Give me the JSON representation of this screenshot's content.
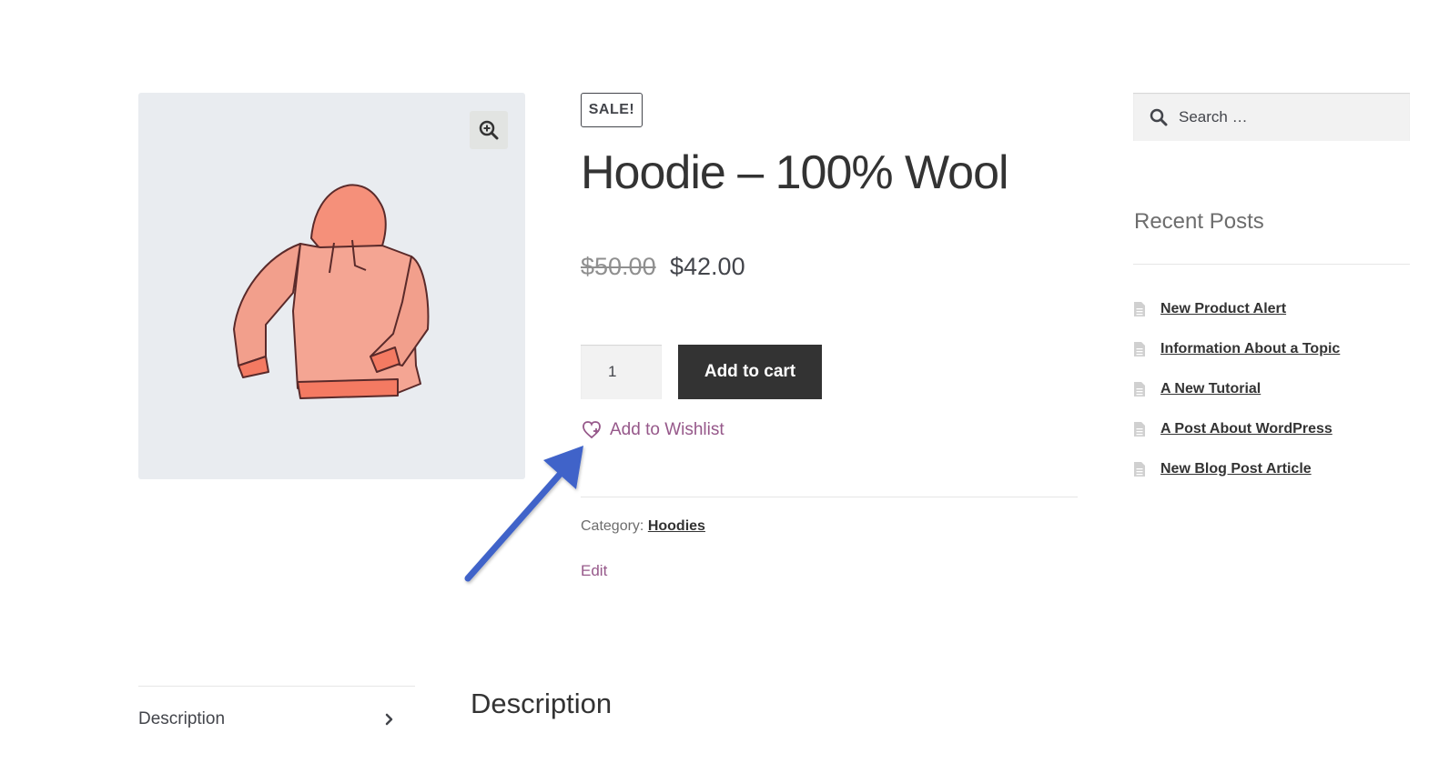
{
  "product": {
    "badge": "SALE!",
    "title": "Hoodie – 100% Wool",
    "price_old": "$50.00",
    "price_new": "$42.00",
    "quantity": "1",
    "add_to_cart_label": "Add to cart",
    "wishlist_label": "Add to Wishlist",
    "category_label": "Category:",
    "category_value": "Hoodies",
    "edit_label": "Edit",
    "image_icon": "hoodie-image",
    "zoom_icon": "magnifier-plus-icon"
  },
  "sidebar": {
    "search_placeholder": "Search …",
    "recent_posts_title": "Recent Posts",
    "posts": [
      {
        "label": "New Product Alert"
      },
      {
        "label": "Information About a Topic"
      },
      {
        "label": "A New Tutorial"
      },
      {
        "label": "A Post About WordPress"
      },
      {
        "label": "New Blog Post Article"
      }
    ]
  },
  "tabs": {
    "description_tab": "Description",
    "description_heading": "Description"
  },
  "colors": {
    "accent": "#96588a",
    "button_bg": "#333333",
    "arrow": "#3f63c9"
  }
}
